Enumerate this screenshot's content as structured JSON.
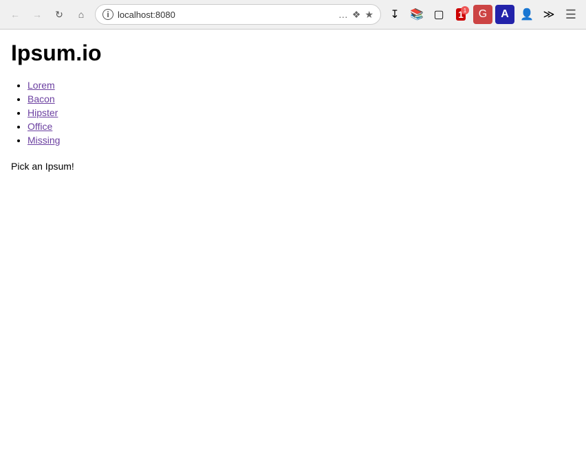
{
  "browser": {
    "url": "localhost:8080",
    "back_title": "Back",
    "forward_title": "Forward",
    "reload_title": "Reload",
    "home_title": "Home",
    "more_title": "More",
    "bookmark_title": "Bookmark",
    "download_title": "Download",
    "library_title": "Library",
    "tabs_title": "Tabs",
    "extensions_more_title": "More extensions",
    "menu_title": "Menu"
  },
  "page": {
    "title": "Ipsum.io",
    "nav_items": [
      {
        "label": "Lorem",
        "href": "#"
      },
      {
        "label": "Bacon",
        "href": "#"
      },
      {
        "label": "Hipster",
        "href": "#"
      },
      {
        "label": "Office",
        "href": "#"
      },
      {
        "label": "Missing",
        "href": "#"
      }
    ],
    "prompt": "Pick an Ipsum!"
  }
}
